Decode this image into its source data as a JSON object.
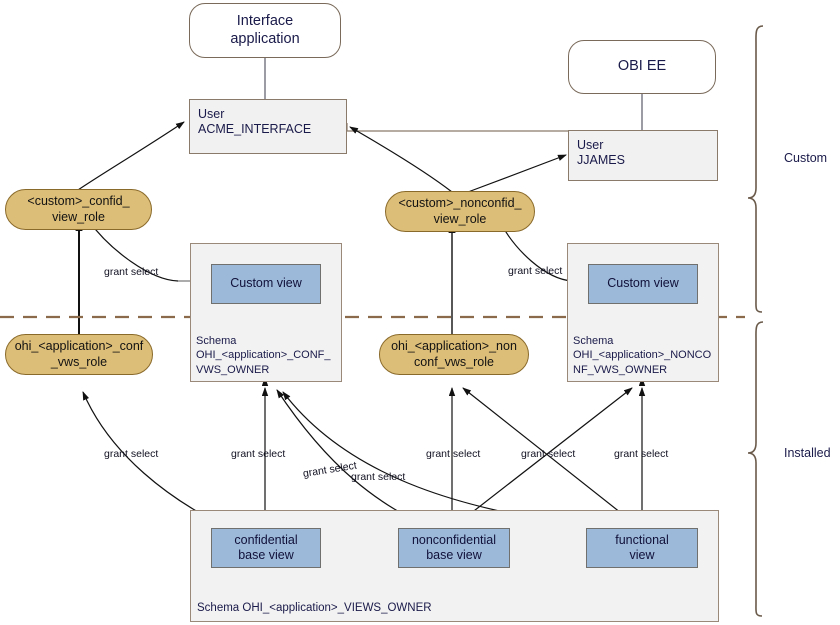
{
  "diagram": {
    "title": "OHI application roles, views and schemas",
    "colors": {
      "role_fill": "#ddbe78",
      "view_fill": "#9cb9d9",
      "schema_fill": "#f2f2f2",
      "user_fill": "#f1f1f1",
      "divider": "#8a6a4a"
    }
  },
  "apps": {
    "interface_application": "Interface\napplication",
    "obi_ee": "OBI EE"
  },
  "users": {
    "acme_interface": {
      "line1": "User",
      "line2": "ACME_INTERFACE"
    },
    "jjames": {
      "line1": "User",
      "line2": "JJAMES"
    }
  },
  "roles": {
    "custom_confid": "<custom>_confid_\nview_role",
    "custom_nonconfid": "<custom>_nonconfid_\nview_role",
    "ohi_conf": "ohi_<application>_conf\n_vws_role",
    "ohi_nonconf": "ohi_<application>_non\nconf_vws_role"
  },
  "schemas": {
    "conf_vws_owner": {
      "label": "Schema\nOHI_<application>_CONF_\nVWS_OWNER",
      "view": "Custom view"
    },
    "nonconf_vws_owner": {
      "label": "Schema\nOHI_<application>_NONCO\nNF_VWS_OWNER",
      "view": "Custom view"
    },
    "views_owner": {
      "label": "Schema OHI_<application>_VIEWS_OWNER",
      "views": [
        "confidential\nbase view",
        "nonconfidential\nbase view",
        "functional\nview"
      ]
    }
  },
  "edge_labels": {
    "grant_select": "grant select",
    "items": [
      "grant select",
      "grant select",
      "grant select",
      "grant select",
      "grant select",
      "grant select",
      "grant select",
      "grant select",
      "grant select",
      "grant select"
    ]
  },
  "braces": {
    "custom": "Custom",
    "installed": "Installed"
  }
}
